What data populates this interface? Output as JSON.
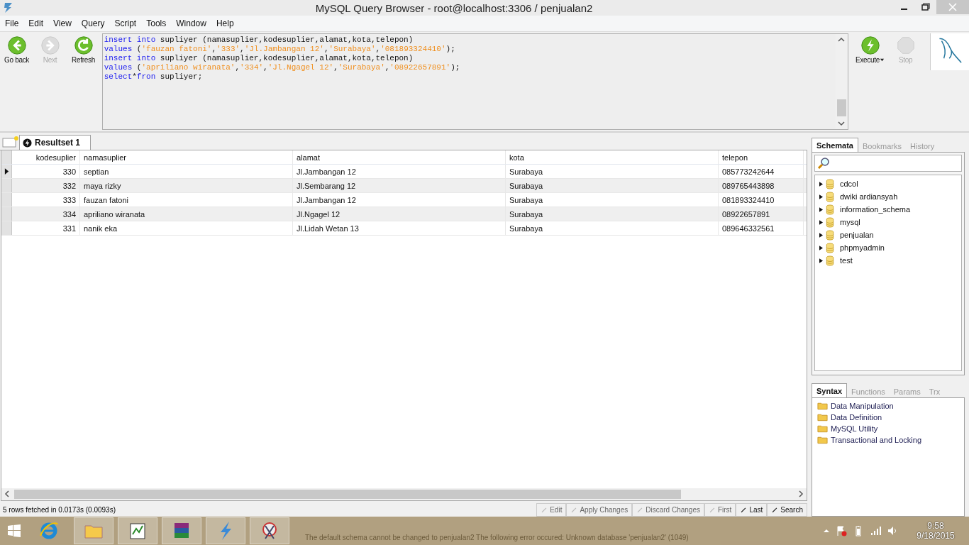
{
  "window": {
    "title": "MySQL Query Browser - root@localhost:3306 / penjualan2"
  },
  "menu": [
    "File",
    "Edit",
    "View",
    "Query",
    "Script",
    "Tools",
    "Window",
    "Help"
  ],
  "nav_buttons": [
    {
      "label": "Go back",
      "kind": "back",
      "disabled": false
    },
    {
      "label": "Next",
      "kind": "next",
      "disabled": true
    },
    {
      "label": "Refresh",
      "kind": "refresh",
      "disabled": false
    }
  ],
  "query_lines": [
    [
      {
        "kind": "keyword",
        "text": "insert into"
      },
      {
        "kind": "plain",
        "text": " supliyer (namasuplier,kodesuplier,alamat,kota,telepon)"
      }
    ],
    [
      {
        "kind": "keyword",
        "text": "values"
      },
      {
        "kind": "plain",
        "text": " ("
      },
      {
        "kind": "string",
        "text": "'fauzan fatoni'"
      },
      {
        "kind": "plain",
        "text": ","
      },
      {
        "kind": "string",
        "text": "'333'"
      },
      {
        "kind": "plain",
        "text": ","
      },
      {
        "kind": "string",
        "text": "'Jl.Jambangan 12'"
      },
      {
        "kind": "plain",
        "text": ","
      },
      {
        "kind": "string",
        "text": "'Surabaya'"
      },
      {
        "kind": "plain",
        "text": ","
      },
      {
        "kind": "string",
        "text": "'081893324410'"
      },
      {
        "kind": "plain",
        "text": ");"
      }
    ],
    [
      {
        "kind": "keyword",
        "text": "insert into"
      },
      {
        "kind": "plain",
        "text": " supliyer (namasuplier,kodesuplier,alamat,kota,telepon)"
      }
    ],
    [
      {
        "kind": "keyword",
        "text": "values"
      },
      {
        "kind": "plain",
        "text": " ("
      },
      {
        "kind": "string",
        "text": "'apriliano wiranata'"
      },
      {
        "kind": "plain",
        "text": ","
      },
      {
        "kind": "string",
        "text": "'334'"
      },
      {
        "kind": "plain",
        "text": ","
      },
      {
        "kind": "string",
        "text": "'Jl.Ngagel 12'"
      },
      {
        "kind": "plain",
        "text": ","
      },
      {
        "kind": "string",
        "text": "'Surabaya'"
      },
      {
        "kind": "plain",
        "text": ","
      },
      {
        "kind": "string",
        "text": "'08922657891'"
      },
      {
        "kind": "plain",
        "text": ");"
      }
    ],
    [
      {
        "kind": "keyword",
        "text": "select"
      },
      {
        "kind": "plain",
        "text": "*"
      },
      {
        "kind": "keyword",
        "text": "fron"
      },
      {
        "kind": "plain",
        "text": " supliyer;"
      }
    ]
  ],
  "run_buttons": [
    {
      "label": "Execute",
      "kind": "execute",
      "disabled": false
    },
    {
      "label": "Stop",
      "kind": "stop",
      "disabled": true
    }
  ],
  "result_tab": {
    "label": "Resultset 1"
  },
  "table": {
    "columns": [
      "kodesuplier",
      "namasuplier",
      "alamat",
      "kota",
      "telepon"
    ],
    "rows": [
      {
        "cells": [
          "330",
          "septian",
          "Jl.Jambangan 12",
          "Surabaya",
          "085773242644"
        ],
        "selected": true
      },
      {
        "cells": [
          "332",
          "maya rizky",
          "Jl.Sembarang 12",
          "Surabaya",
          "089765443898"
        ],
        "selected": false
      },
      {
        "cells": [
          "333",
          "fauzan fatoni",
          "Jl.Jambangan 12",
          "Surabaya",
          "081893324410"
        ],
        "selected": false
      },
      {
        "cells": [
          "334",
          "apriliano wiranata",
          "Jl.Ngagel 12",
          "Surabaya",
          "08922657891"
        ],
        "selected": false
      },
      {
        "cells": [
          "331",
          "nanik eka",
          "Jl.Lidah Wetan 13",
          "Surabaya",
          "089646332561"
        ],
        "selected": false
      }
    ]
  },
  "edit_buttons": [
    {
      "label": "Edit",
      "disabled": true
    },
    {
      "label": "Apply Changes",
      "disabled": true
    },
    {
      "label": "Discard Changes",
      "disabled": true
    },
    {
      "label": "First",
      "disabled": true
    },
    {
      "label": "Last",
      "disabled": false
    },
    {
      "label": "Search",
      "disabled": false
    }
  ],
  "status": {
    "rows": "5 rows fetched in 0.0173s (0.0093s)",
    "message": "The default schema cannot be changed to penjualan2  The following error occured: Unknown database 'penjualan2' (1049)"
  },
  "schema_tabs": [
    {
      "label": "Schemata",
      "selected": true
    },
    {
      "label": "Bookmarks",
      "selected": false
    },
    {
      "label": "History",
      "selected": false
    }
  ],
  "schemata": [
    "cdcol",
    "dwiki ardiansyah",
    "information_schema",
    "mysql",
    "penjualan",
    "phpmyadmin",
    "test"
  ],
  "syntax_tabs": [
    {
      "label": "Syntax",
      "selected": true
    },
    {
      "label": "Functions",
      "selected": false
    },
    {
      "label": "Params",
      "selected": false
    },
    {
      "label": "Trx",
      "selected": false
    }
  ],
  "syntax_items": [
    "Data Manipulation",
    "Data Definition",
    "MySQL Utility",
    "Transactional and Locking"
  ],
  "taskbar": {
    "time": "9:58",
    "date": "9/18/2015"
  }
}
